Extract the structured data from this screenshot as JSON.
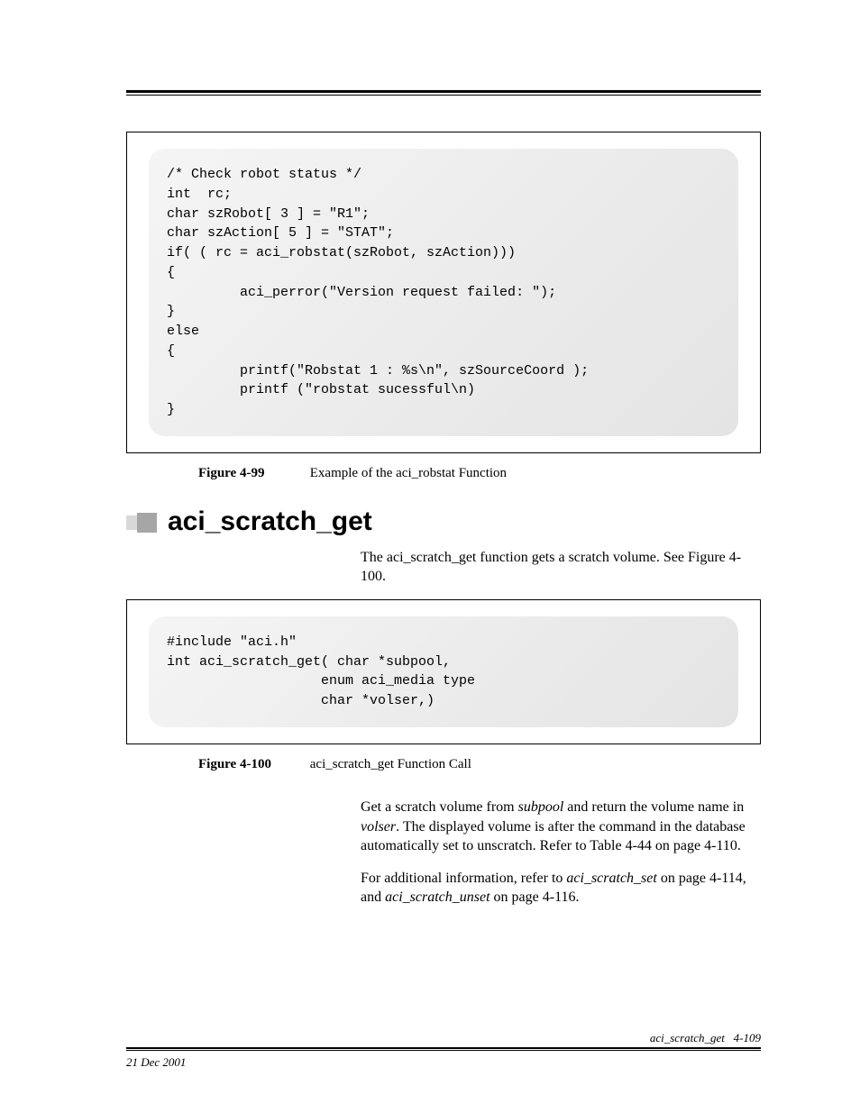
{
  "code1": "/* Check robot status */\nint  rc;\nchar szRobot[ 3 ] = \"R1\";\nchar szAction[ 5 ] = \"STAT\";\nif( ( rc = aci_robstat(szRobot, szAction)))\n{\n         aci_perror(\"Version request failed: \");\n}\nelse\n{\n         printf(\"Robstat 1 : %s\\n\", szSourceCoord );\n         printf (\"robstat sucessful\\n)\n}",
  "fig99_num": "Figure 4-99",
  "fig99_cap": "Example of the aci_robstat Function",
  "heading": "aci_scratch_get",
  "intro": "The aci_scratch_get function gets a scratch volume. See Figure 4-100.",
  "code2": "#include \"aci.h\"\nint aci_scratch_get( char *subpool,\n                   enum aci_media type\n                   char *volser,)",
  "fig100_num": "Figure 4-100",
  "fig100_cap": "aci_scratch_get Function Call",
  "para2_a": "Get a scratch volume from ",
  "para2_em1": "subpool",
  "para2_b": " and return the volume name in ",
  "para2_em2": "volser",
  "para2_c": ". The displayed volume is after the command in the database automatically set to unscratch. Refer to Table 4-44 on page 4-110.",
  "para3_a": "For additional information, refer to ",
  "para3_em1": "aci_scratch_set",
  "para3_b": "  on page 4-114, and ",
  "para3_em2": "aci_scratch_unset",
  "para3_c": "  on page 4-116.",
  "footer_date": "21 Dec 2001",
  "footer_sec": "aci_scratch_get",
  "footer_pg": "4-109"
}
